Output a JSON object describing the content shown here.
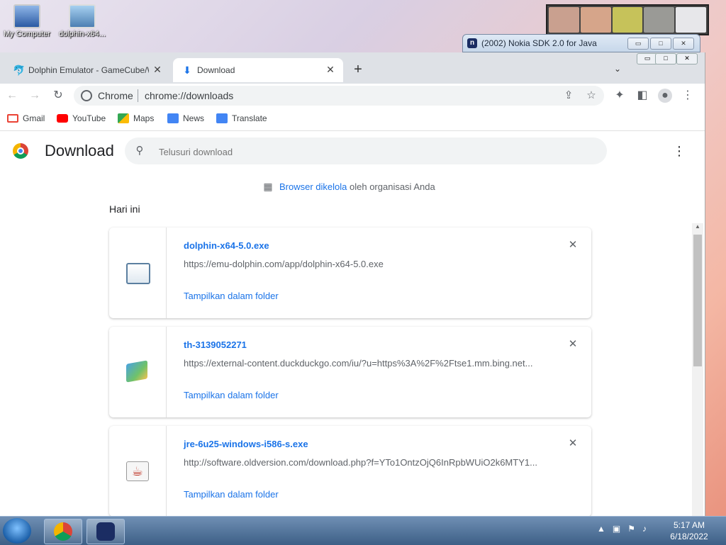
{
  "desktop": {
    "icons": [
      {
        "label": "My Computer"
      },
      {
        "label": "dolphin-x64..."
      }
    ]
  },
  "background_window": {
    "title": "(2002) Nokia SDK 2.0 for Java",
    "app_icon_letter": "n"
  },
  "browser": {
    "tabs": [
      {
        "label": "Dolphin Emulator - GameCube/W",
        "icon": "dolphin-icon",
        "active": false
      },
      {
        "label": "Download",
        "icon": "download-icon",
        "active": true
      }
    ],
    "omnibox": {
      "site_label": "Chrome",
      "url": "chrome://downloads"
    },
    "bookmarks": [
      {
        "label": "Gmail",
        "color": "#ea4335"
      },
      {
        "label": "YouTube",
        "color": "#ff0000"
      },
      {
        "label": "Maps",
        "color": "#34a853"
      },
      {
        "label": "News",
        "color": "#4285f4"
      },
      {
        "label": "Translate",
        "color": "#4285f4"
      }
    ]
  },
  "downloads_page": {
    "title": "Download",
    "search_placeholder": "Telusuri download",
    "managed_link": "Browser dikelola",
    "managed_text": "oleh organisasi Anda",
    "section_label": "Hari ini",
    "items": [
      {
        "filename": "dolphin-x64-5.0.exe",
        "url": "https://emu-dolphin.com/app/dolphin-x64-5.0.exe",
        "action": "Tampilkan dalam folder",
        "icon": "exe-file-icon"
      },
      {
        "filename": "th-3139052271",
        "url": "https://external-content.duckduckgo.com/iu/?u=https%3A%2F%2Ftse1.mm.bing.net...",
        "action": "Tampilkan dalam folder",
        "icon": "image-file-icon"
      },
      {
        "filename": "jre-6u25-windows-i586-s.exe",
        "url": "http://software.oldversion.com/download.php?f=YTo1OntzOjQ6InRpbWUiO2k6MTY1...",
        "action": "Tampilkan dalam folder",
        "icon": "java-file-icon"
      }
    ]
  },
  "taskbar": {
    "time": "5:17 AM",
    "date": "6/18/2022"
  },
  "colors": {
    "link_blue": "#1a73e8",
    "text_gray": "#5f6368",
    "tabstrip_bg": "#dee1e6"
  }
}
